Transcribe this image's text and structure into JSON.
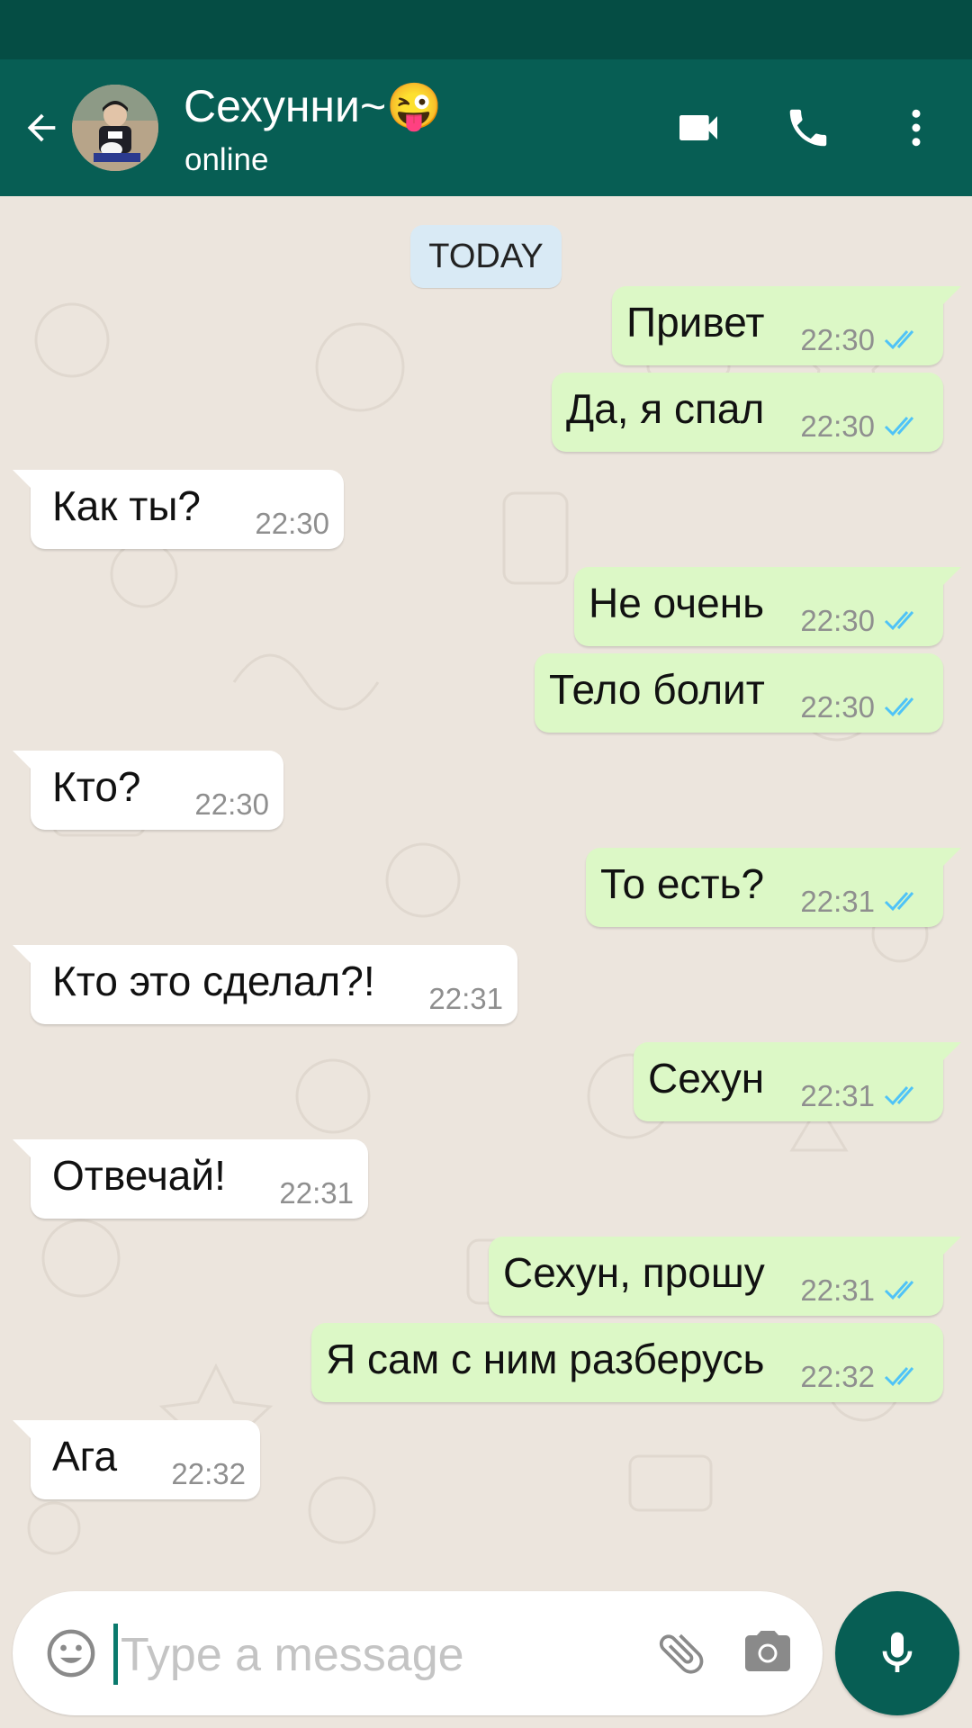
{
  "colors": {
    "header": "#075e54",
    "status_bar": "#054d44",
    "chat_background": "#ece5dd",
    "outgoing_bubble": "#dcf8c6",
    "incoming_bubble": "#ffffff",
    "read_ticks": "#4fc3f7",
    "date_chip": "#d9eaf5",
    "mic_button": "#075e54"
  },
  "header": {
    "contact_name": "Сехунни~😜",
    "status": "online",
    "icons": [
      "back-arrow-icon",
      "video-call-icon",
      "phone-icon",
      "more-vert-icon"
    ]
  },
  "chat": {
    "date_label": "TODAY",
    "messages": [
      {
        "dir": "out",
        "text": "Привет",
        "time": "22:30",
        "status": "read"
      },
      {
        "dir": "out",
        "text": "Да, я спал",
        "time": "22:30",
        "status": "read"
      },
      {
        "dir": "in",
        "text": "Как ты?",
        "time": "22:30"
      },
      {
        "dir": "out",
        "text": "Не очень",
        "time": "22:30",
        "status": "read"
      },
      {
        "dir": "out",
        "text": "Тело болит",
        "time": "22:30",
        "status": "read"
      },
      {
        "dir": "in",
        "text": "Кто?",
        "time": "22:30"
      },
      {
        "dir": "out",
        "text": "То есть?",
        "time": "22:31",
        "status": "read"
      },
      {
        "dir": "in",
        "text": "Кто это сделал?!",
        "time": "22:31"
      },
      {
        "dir": "out",
        "text": "Сехун",
        "time": "22:31",
        "status": "read"
      },
      {
        "dir": "in",
        "text": "Отвечай!",
        "time": "22:31"
      },
      {
        "dir": "out",
        "text": "Сехун, прошу",
        "time": "22:31",
        "status": "read"
      },
      {
        "dir": "out",
        "text": "Я сам с ним разберусь",
        "time": "22:32",
        "status": "read"
      },
      {
        "dir": "in",
        "text": "Ага",
        "time": "22:32"
      }
    ]
  },
  "composer": {
    "placeholder": "Type a message",
    "value": "",
    "icons": [
      "emoji-icon",
      "attach-icon",
      "camera-icon",
      "mic-icon"
    ]
  }
}
